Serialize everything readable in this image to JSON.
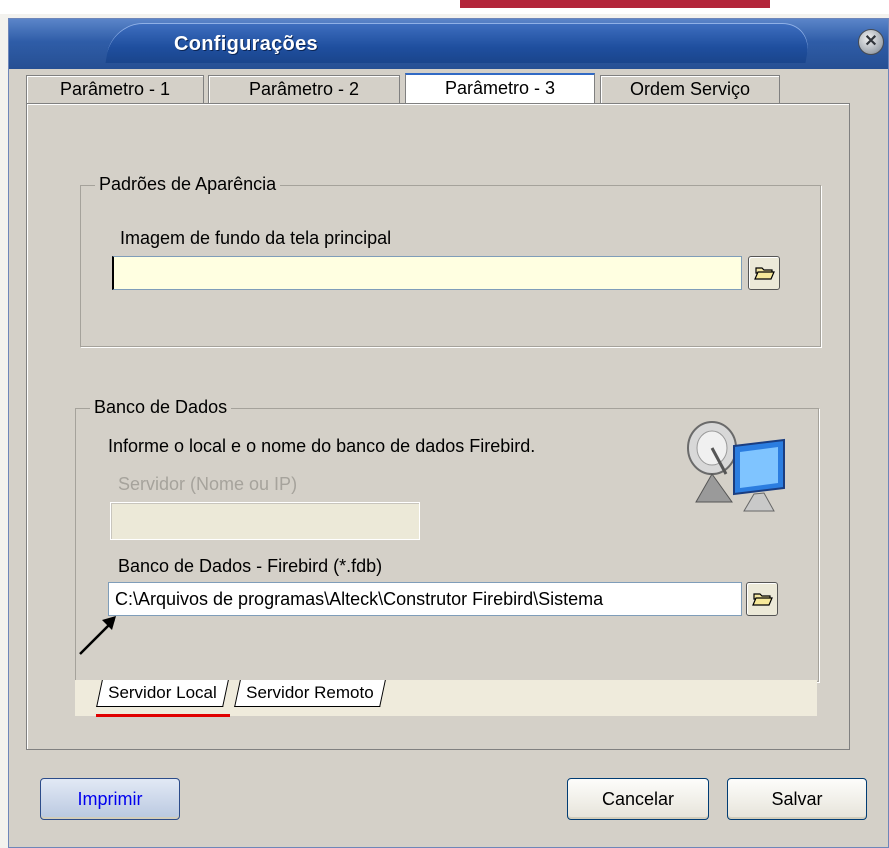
{
  "window": {
    "title": "Configurações",
    "close_glyph": "✕"
  },
  "tabs": [
    {
      "label": "Parâmetro - 1",
      "active": false
    },
    {
      "label": "Parâmetro - 2",
      "active": false
    },
    {
      "label": "Parâmetro - 3",
      "active": true
    },
    {
      "label": "Ordem Serviço",
      "active": false
    }
  ],
  "appearance": {
    "legend": "Padrões de Aparência",
    "background_label": "Imagem de fundo da tela principal",
    "background_value": "",
    "browse_icon": "folder-open-icon"
  },
  "database": {
    "legend": "Banco de Dados",
    "info": "Informe o local e o nome do banco de dados Firebird.",
    "server_label": "Servidor (Nome ou IP)",
    "server_value": "",
    "db_label": "Banco de Dados - Firebird (*.fdb)",
    "db_value": "C:\\Arquivos de programas\\Alteck\\Construtor Firebird\\Sistema",
    "browse_icon": "folder-open-icon",
    "illustration_icon": "network-computer-icon"
  },
  "subtabs": [
    {
      "label": "Servidor Local",
      "active": true
    },
    {
      "label": "Servidor Remoto",
      "active": false
    }
  ],
  "footer": {
    "print_label": "Imprimir",
    "cancel_label": "Cancelar",
    "save_label": "Salvar"
  },
  "colors": {
    "title_bar": "#2f5da8",
    "input_highlight": "#ffffe1",
    "disabled_input": "#ece9d8",
    "annotation_red": "#e00000",
    "print_label": "#0000ee"
  }
}
